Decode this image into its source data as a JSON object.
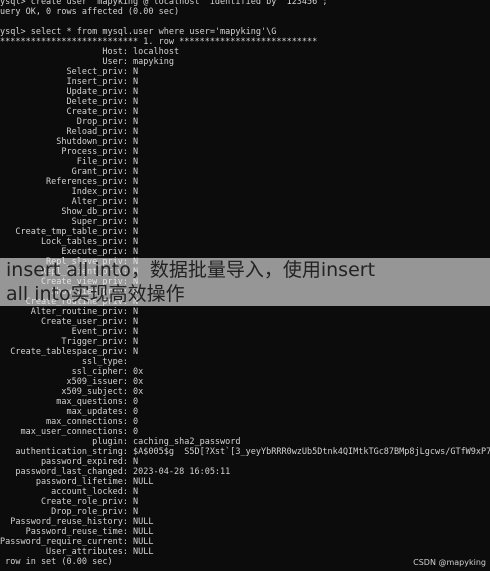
{
  "terminal": {
    "lines": [
      "ysql> create user 'mapyking'@'localhost' identified by '123456';",
      "uery OK, 0 rows affected (0.00 sec)",
      "",
      "ysql> select * from mysql.user where user='mapyking'\\G",
      "*************************** 1. row ***************************",
      "                    Host: localhost",
      "                    User: mapyking",
      "             Select_priv: N",
      "             Insert_priv: N",
      "             Update_priv: N",
      "             Delete_priv: N",
      "             Create_priv: N",
      "               Drop_priv: N",
      "             Reload_priv: N",
      "           Shutdown_priv: N",
      "            Process_priv: N",
      "               File_priv: N",
      "              Grant_priv: N",
      "         References_priv: N",
      "              Index_priv: N",
      "              Alter_priv: N",
      "            Show_db_priv: N",
      "              Super_priv: N",
      "   Create_tmp_table_priv: N",
      "        Lock_tables_priv: N",
      "            Execute_priv: N",
      "         Repl_slave_priv: N",
      "        Repl_client_priv: N",
      "        Create_view_priv: N",
      "          Show_view_priv: N",
      "     Create_routine_priv: N",
      "      Alter_routine_priv: N",
      "        Create_user_priv: N",
      "              Event_priv: N",
      "            Trigger_priv: N",
      "  Create_tablespace_priv: N",
      "                ssl_type:",
      "              ssl_cipher: 0x",
      "             x509_issuer: 0x",
      "            x509_subject: 0x",
      "           max_questions: 0",
      "             max_updates: 0",
      "         max_connections: 0",
      "    max_user_connections: 0",
      "                  plugin: caching_sha2_password",
      "   authentication_string: $A$005$g  S5D[?Xst`[3_yeyYbRRR0wzUb5Dtnk4QIMtkTGc87BMp8jLgcws/GTfW9xP7",
      "        password_expired: N",
      "   password_last_changed: 2023-04-28 16:05:11",
      "       password_lifetime: NULL",
      "          account_locked: N",
      "        Create_role_priv: N",
      "          Drop_role_priv: N",
      "  Password_reuse_history: NULL",
      "     Password_reuse_time: NULL",
      "Password_require_current: NULL",
      "         User_attributes: NULL",
      " row in set (0.00 sec)",
      "",
      "ysql> "
    ]
  },
  "banner": {
    "line1": "insert all into，数据批量导入，使用insert",
    "line2": " all into实现高效操作"
  },
  "watermark": "CSDN @mapyking"
}
